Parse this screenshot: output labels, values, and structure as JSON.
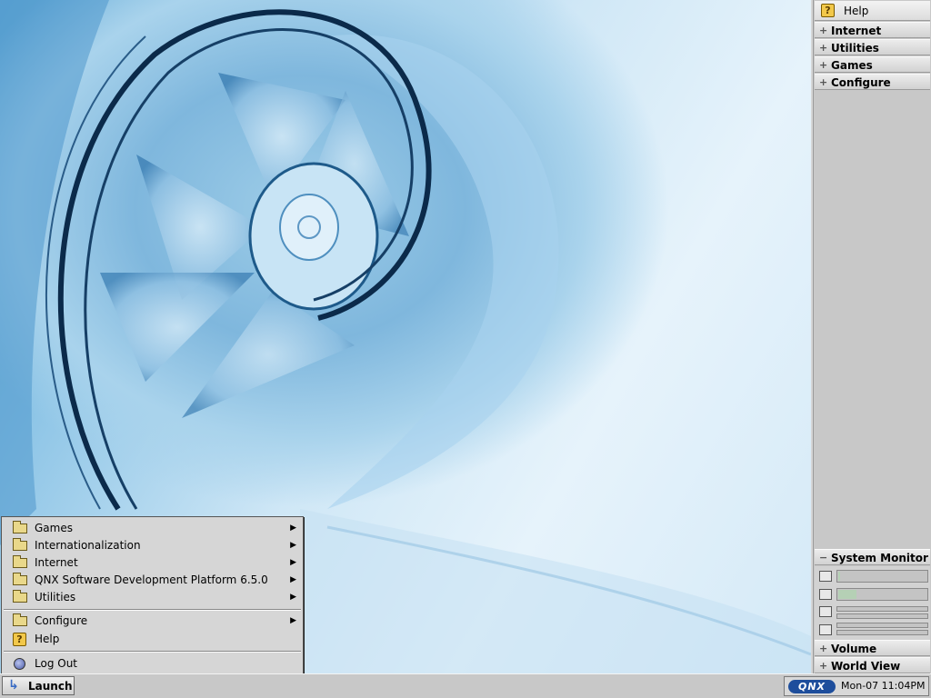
{
  "shelf": {
    "help_label": "Help",
    "groups": [
      {
        "label": "Internet",
        "expander": "+"
      },
      {
        "label": "Utilities",
        "expander": "+"
      },
      {
        "label": "Games",
        "expander": "+"
      },
      {
        "label": "Configure",
        "expander": "+"
      }
    ],
    "system_monitor": {
      "label": "System Monitor",
      "expander": "−",
      "cpu_usage": 0.02,
      "memory_usage": 0.2,
      "icons": [
        "cpu-icon",
        "memory-icon",
        "network-icon",
        "disk-icon"
      ]
    },
    "volume_label": "Volume",
    "volume_expander": "+",
    "world_view_label": "World View",
    "world_view_expander": "+"
  },
  "launch_menu": {
    "items": [
      {
        "label": "Games",
        "icon": "folder-icon",
        "submenu": true
      },
      {
        "label": "Internationalization",
        "icon": "folder-icon",
        "submenu": true
      },
      {
        "label": "Internet",
        "icon": "folder-icon",
        "submenu": true
      },
      {
        "label": "QNX Software Development Platform 6.5.0",
        "icon": "folder-icon",
        "submenu": true
      },
      {
        "label": "Utilities",
        "icon": "folder-icon",
        "submenu": true
      }
    ],
    "configure_label": "Configure",
    "help_label": "Help",
    "logout_label": "Log Out",
    "arrow": "▶",
    "help_glyph": "?"
  },
  "taskbar": {
    "launch_label": "Launch",
    "launch_arrow": "↳",
    "logo_text": "QNX",
    "clock": "Mon-07 11:04PM"
  },
  "colors": {
    "accent": "#3a6cc4",
    "wallpaper_dark": "#0b2a4a",
    "wallpaper_light": "#e6f3fb"
  }
}
